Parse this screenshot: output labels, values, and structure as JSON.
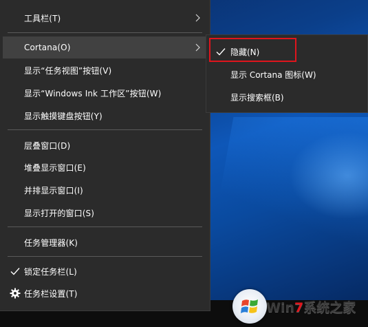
{
  "context_menu": {
    "items": [
      {
        "label": "工具栏(T)",
        "submenu": true
      },
      {
        "label": "Cortana(O)",
        "submenu": true,
        "hovered": true
      },
      {
        "label": "显示“任务视图”按钮(V)"
      },
      {
        "label": "显示“Windows Ink 工作区”按钮(W)"
      },
      {
        "label": "显示触摸键盘按钮(Y)"
      },
      {
        "label": "层叠窗口(D)"
      },
      {
        "label": "堆叠显示窗口(E)"
      },
      {
        "label": "并排显示窗口(I)"
      },
      {
        "label": "显示打开的窗口(S)"
      },
      {
        "label": "任务管理器(K)"
      },
      {
        "label": "锁定任务栏(L)",
        "checked": true,
        "icon": "checkmark-icon"
      },
      {
        "label": "任务栏设置(T)",
        "icon": "gear-icon"
      }
    ]
  },
  "cortana_submenu": {
    "items": [
      {
        "label": "隐藏(N)",
        "checked": true,
        "highlighted": true,
        "icon": "checkmark-icon"
      },
      {
        "label": "显示 Cortana 图标(W)"
      },
      {
        "label": "显示搜索框(B)"
      }
    ]
  },
  "watermark": {
    "w": "Win",
    "seven": "7",
    "rest": "系统之家"
  },
  "colors": {
    "menu_bg": "#2b2b2b",
    "hover_bg": "#414141",
    "separator": "#5a5a5a",
    "highlight_border": "#e0151d",
    "desktop_blue": "#0b3f8a"
  }
}
